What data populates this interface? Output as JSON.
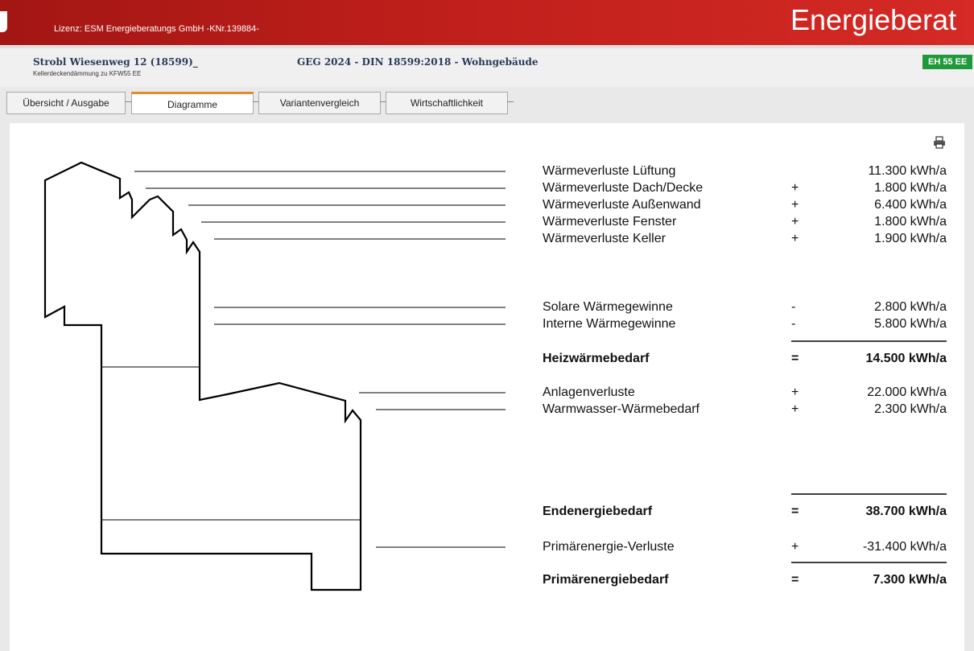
{
  "app": {
    "license": "Lizenz: ESM Energieberatungs GmbH  -KNr.139884-",
    "title": "Energieberat"
  },
  "project": {
    "title": "Strobl Wiesenweg 12  (18599)_",
    "subtitle": "Kellerdeckendämmung zu KFW55 EE",
    "norm": "GEG 2024 - DIN 18599:2018  -  Wohngebäude",
    "badge": "EH 55 EE"
  },
  "tabs": [
    {
      "label": "Übersicht / Ausgabe"
    },
    {
      "label": "Diagramme"
    },
    {
      "label": "Variantenvergleich"
    },
    {
      "label": "Wirtschaftlichkeit"
    }
  ],
  "rows": [
    {
      "label": "Wärmeverluste Lüftung",
      "op": "",
      "value": "11.300 kWh/a"
    },
    {
      "label": "Wärmeverluste Dach/Decke",
      "op": "+",
      "value": "1.800 kWh/a"
    },
    {
      "label": "Wärmeverluste Außenwand",
      "op": "+",
      "value": "6.400 kWh/a"
    },
    {
      "label": "Wärmeverluste Fenster",
      "op": "+",
      "value": "1.800 kWh/a"
    },
    {
      "label": "Wärmeverluste Keller",
      "op": "+",
      "value": "1.900 kWh/a"
    },
    {
      "label": "Solare Wärmegewinne",
      "op": "-",
      "value": "2.800 kWh/a"
    },
    {
      "label": "Interne Wärmegewinne",
      "op": "-",
      "value": "5.800 kWh/a"
    },
    {
      "label": "Heizwärmebedarf",
      "op": "=",
      "value": "14.500 kWh/a"
    },
    {
      "label": "Anlagenverluste",
      "op": "+",
      "value": "22.000 kWh/a"
    },
    {
      "label": "Warmwasser-Wärmebedarf",
      "op": "+",
      "value": "2.300 kWh/a"
    },
    {
      "label": "Endenergiebedarf",
      "op": "=",
      "value": "38.700 kWh/a"
    },
    {
      "label": "Primärenergie-Verluste",
      "op": "+",
      "value": "-31.400 kWh/a"
    },
    {
      "label": "Primärenergiebedarf",
      "op": "=",
      "value": "7.300 kWh/a"
    }
  ]
}
